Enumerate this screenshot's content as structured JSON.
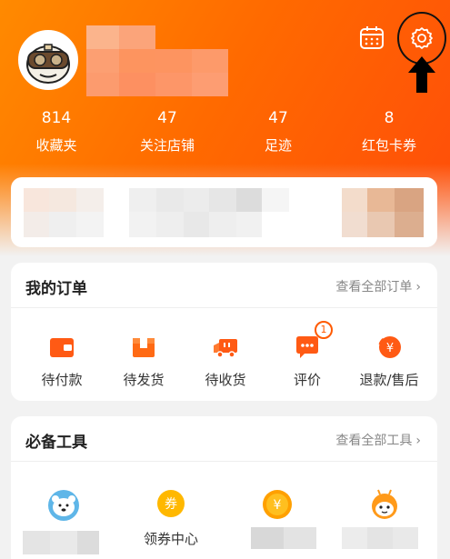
{
  "colors": {
    "accent": "#ff6a00",
    "accent_light": "#ff8a00"
  },
  "profile": {
    "avatar_icon": "cartoon-avatar"
  },
  "header": {
    "calendar_icon": "calendar-icon",
    "settings_icon": "gear-icon"
  },
  "stats": [
    {
      "value": "814",
      "label": "收藏夹"
    },
    {
      "value": "47",
      "label": "关注店铺"
    },
    {
      "value": "47",
      "label": "足迹"
    },
    {
      "value": "8",
      "label": "红包卡券"
    }
  ],
  "orders": {
    "title": "我的订单",
    "link": "查看全部订单",
    "items": [
      {
        "label": "待付款",
        "icon": "wallet-icon"
      },
      {
        "label": "待发货",
        "icon": "package-icon"
      },
      {
        "label": "待收货",
        "icon": "truck-icon"
      },
      {
        "label": "评价",
        "icon": "comment-icon",
        "badge": "1"
      },
      {
        "label": "退款/售后",
        "icon": "refund-icon"
      }
    ]
  },
  "tools": {
    "title": "必备工具",
    "link": "查看全部工具",
    "items": [
      {
        "label": "",
        "icon": "polar-bear-icon"
      },
      {
        "label": "领券中心",
        "icon": "coupon-icon"
      },
      {
        "label": "",
        "icon": "yen-coin-icon"
      },
      {
        "label": "",
        "icon": "bee-mascot-icon"
      }
    ]
  }
}
